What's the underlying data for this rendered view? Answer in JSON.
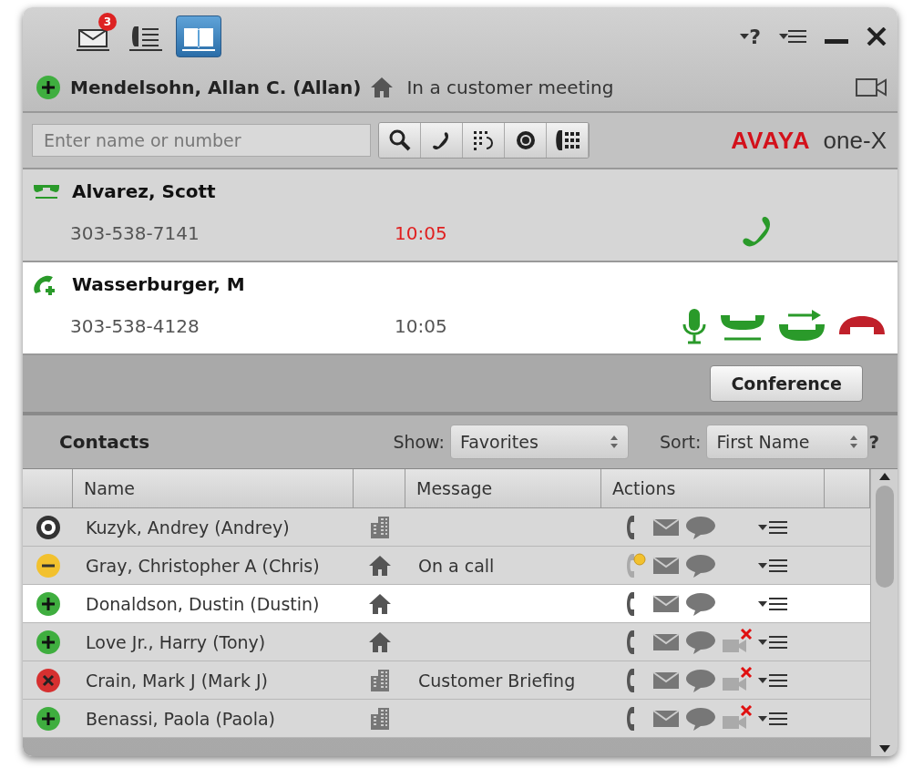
{
  "tabs": [
    {
      "kind": "messages",
      "badge": "3",
      "selected": false
    },
    {
      "kind": "call-log",
      "selected": false
    },
    {
      "kind": "contacts",
      "selected": true
    }
  ],
  "window_controls": [
    {
      "kind": "help",
      "label": "?"
    },
    {
      "kind": "menu"
    },
    {
      "kind": "minimize"
    },
    {
      "kind": "close"
    }
  ],
  "user": {
    "color": "#3fae3f",
    "name": "Mendelsohn, Allan C. (Allan)",
    "at_home": true,
    "status": "In a customer meeting"
  },
  "search": {
    "placeholder": "Enter name or number"
  },
  "search_tools": [
    {
      "kind": "search"
    },
    {
      "kind": "call"
    },
    {
      "kind": "redial"
    },
    {
      "kind": "voicemail"
    },
    {
      "kind": "dialpad"
    }
  ],
  "brand": {
    "company": "AVAYA",
    "product": "one-X"
  },
  "calls": [
    {
      "name": "Alvarez, Scott",
      "number": "303-538-7141",
      "time": "10:05",
      "held": true
    },
    {
      "name": "Wasserburger, M",
      "number": "303-538-4128",
      "time": "10:05",
      "held": false
    }
  ],
  "conference_button": "Conference",
  "contacts": {
    "title": "Contacts",
    "show_label": "Show:",
    "show_value": "Favorites",
    "sort_label": "Sort:",
    "sort_value": "First Name",
    "help": "?",
    "columns": [
      "Name",
      "Message",
      "Actions"
    ],
    "rows": [
      {
        "color": "#333333",
        "name": "Kuzyk, Andrey (Andrey)",
        "at_home": false,
        "on_call": false,
        "video_blocked": false,
        "selected": false
      },
      {
        "color": "#f2c12e",
        "name": "Gray, Christopher A (Chris)",
        "at_home": true,
        "message": "On a call",
        "on_call": true,
        "video_blocked": false,
        "selected": false
      },
      {
        "color": "#3fae3f",
        "name": "Donaldson, Dustin (Dustin)",
        "at_home": true,
        "on_call": false,
        "video_blocked": false,
        "selected": true
      },
      {
        "color": "#3fae3f",
        "name": "Love Jr., Harry (Tony)",
        "at_home": true,
        "on_call": false,
        "video_blocked": true,
        "selected": false
      },
      {
        "color": "#d63030",
        "name": "Crain, Mark J (Mark J)",
        "at_home": false,
        "message": "Customer Briefing",
        "on_call": false,
        "video_blocked": true,
        "selected": false
      },
      {
        "color": "#3fae3f",
        "name": "Benassi, Paola (Paola)",
        "at_home": false,
        "on_call": false,
        "video_blocked": true,
        "selected": false
      }
    ]
  }
}
